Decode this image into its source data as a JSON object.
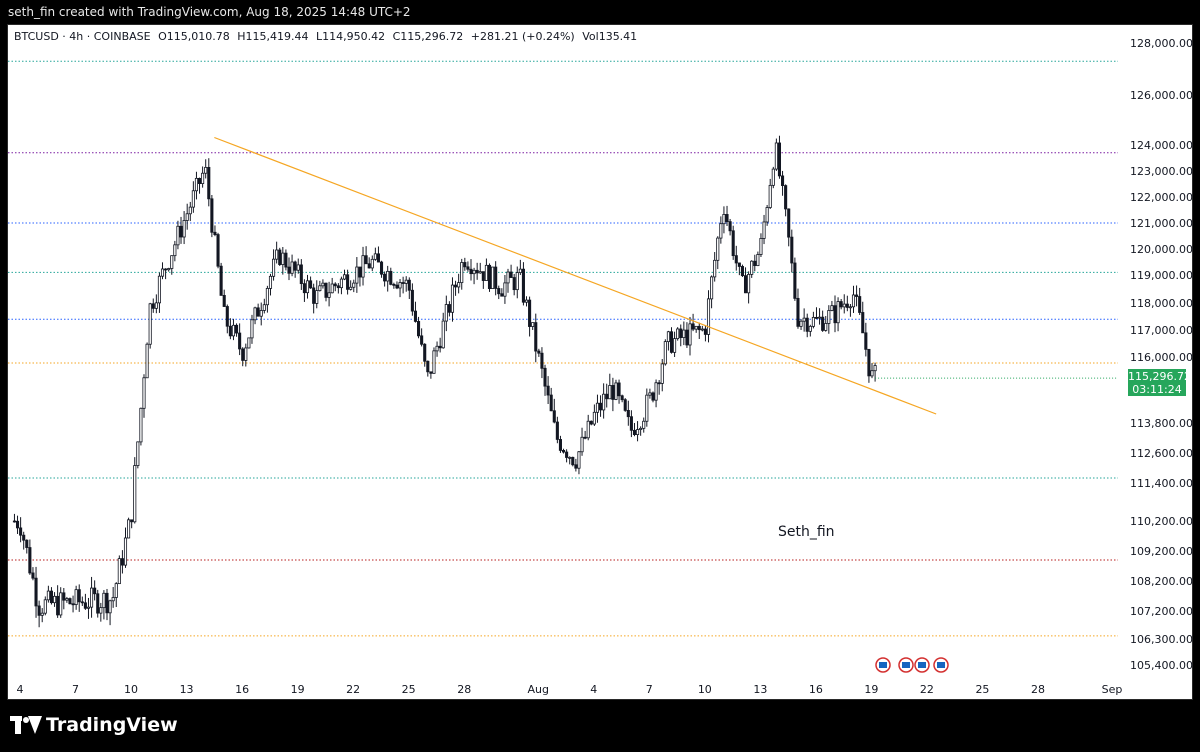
{
  "header": {
    "caption": "seth_fin created with TradingView.com, Aug 18, 2025 14:48 UTC+2"
  },
  "legend": {
    "symbol": "BTCUSD · 4h · COINBASE",
    "open": "O115,010.78",
    "high": "H115,419.44",
    "low": "L114,950.42",
    "close": "C115,296.72",
    "change": "+281.21 (+0.24%)",
    "volume": "Vol135.41"
  },
  "watermark": "Seth_fin",
  "price_tag": {
    "price": "115,296.72",
    "countdown": "03:11:24",
    "color": "#26a65b"
  },
  "footer": {
    "brand": "TradingView"
  },
  "colors": {
    "candle": "#131722",
    "trendline": "#f5a623",
    "level_teal": "#26a69a",
    "level_blue": "#2962ff",
    "level_purple": "#7b1fa2",
    "level_orange": "#f5a623",
    "level_red": "#b71c1c"
  },
  "chart_data": {
    "type": "candlestick",
    "symbol": "BTCUSD",
    "timeframe": "4h",
    "exchange": "COINBASE",
    "y_ticks": [
      "128,000.00",
      "126,000.00",
      "124,000.00",
      "123,000.00",
      "122,000.00",
      "121,000.00",
      "120,000.00",
      "119,000.00",
      "118,000.00",
      "117,000.00",
      "116,000.00",
      "113,800.00",
      "112,600.00",
      "111,400.00",
      "110,200.00",
      "109,200.00",
      "108,200.00",
      "107,200.00",
      "106,300.00",
      "105,400.00"
    ],
    "y_tick_values": [
      128000,
      126000,
      124000,
      123000,
      122000,
      121000,
      120000,
      119000,
      118000,
      117000,
      116000,
      113800,
      112600,
      111400,
      110200,
      109200,
      108200,
      107200,
      106300,
      105400
    ],
    "x_ticks": [
      {
        "label": "4",
        "day": 4
      },
      {
        "label": "7",
        "day": 7
      },
      {
        "label": "10",
        "day": 10
      },
      {
        "label": "13",
        "day": 13
      },
      {
        "label": "16",
        "day": 16
      },
      {
        "label": "19",
        "day": 19
      },
      {
        "label": "22",
        "day": 22
      },
      {
        "label": "25",
        "day": 25
      },
      {
        "label": "28",
        "day": 28
      },
      {
        "label": "Aug",
        "day": 32
      },
      {
        "label": "4",
        "day": 35
      },
      {
        "label": "7",
        "day": 38
      },
      {
        "label": "10",
        "day": 41
      },
      {
        "label": "13",
        "day": 44
      },
      {
        "label": "16",
        "day": 47
      },
      {
        "label": "19",
        "day": 50
      },
      {
        "label": "22",
        "day": 53
      },
      {
        "label": "25",
        "day": 56
      },
      {
        "label": "28",
        "day": 59
      },
      {
        "label": "Sep",
        "day": 63
      }
    ],
    "horizontal_levels": [
      {
        "price": 127300,
        "color": "#26a69a"
      },
      {
        "price": 123700,
        "color": "#7b1fa2"
      },
      {
        "price": 121000,
        "color": "#2962ff"
      },
      {
        "price": 119100,
        "color": "#26a69a"
      },
      {
        "price": 117400,
        "color": "#2962ff"
      },
      {
        "price": 115800,
        "color": "#f5a623"
      },
      {
        "price": 111600,
        "color": "#26a69a"
      },
      {
        "price": 108900,
        "color": "#b71c1c"
      },
      {
        "price": 106400,
        "color": "#f5a623"
      }
    ],
    "trendline": {
      "start": {
        "day": 14.5,
        "price": 124300
      },
      "end": {
        "day": 53.5,
        "price": 114100
      },
      "color": "#f5a623"
    },
    "key_points": [
      {
        "day": 4,
        "price": 110200
      },
      {
        "day": 5,
        "price": 107400
      },
      {
        "day": 9,
        "price": 107600
      },
      {
        "day": 10,
        "price": 110300
      },
      {
        "day": 11,
        "price": 117800
      },
      {
        "day": 14,
        "price": 123100
      },
      {
        "day": 15,
        "price": 117500
      },
      {
        "day": 16,
        "price": 116200
      },
      {
        "day": 18,
        "price": 119800
      },
      {
        "day": 20,
        "price": 118200
      },
      {
        "day": 23,
        "price": 119500
      },
      {
        "day": 25,
        "price": 118600
      },
      {
        "day": 26,
        "price": 115200
      },
      {
        "day": 28,
        "price": 119700
      },
      {
        "day": 30,
        "price": 118600
      },
      {
        "day": 31,
        "price": 118900
      },
      {
        "day": 32,
        "price": 116000
      },
      {
        "day": 33,
        "price": 113200
      },
      {
        "day": 34,
        "price": 112300
      },
      {
        "day": 35,
        "price": 114000
      },
      {
        "day": 36,
        "price": 115000
      },
      {
        "day": 37,
        "price": 113500
      },
      {
        "day": 38,
        "price": 114500
      },
      {
        "day": 39,
        "price": 116500
      },
      {
        "day": 40,
        "price": 116800
      },
      {
        "day": 41,
        "price": 117000
      },
      {
        "day": 42,
        "price": 121800
      },
      {
        "day": 43,
        "price": 118500
      },
      {
        "day": 44,
        "price": 120000
      },
      {
        "day": 44.8,
        "price": 124000
      },
      {
        "day": 45.5,
        "price": 120500
      },
      {
        "day": 46,
        "price": 117500
      },
      {
        "day": 47,
        "price": 117300
      },
      {
        "day": 48,
        "price": 117600
      },
      {
        "day": 49,
        "price": 118400
      },
      {
        "day": 49.5,
        "price": 117000
      },
      {
        "day": 50,
        "price": 115300
      }
    ],
    "last_price": 115296.72
  }
}
